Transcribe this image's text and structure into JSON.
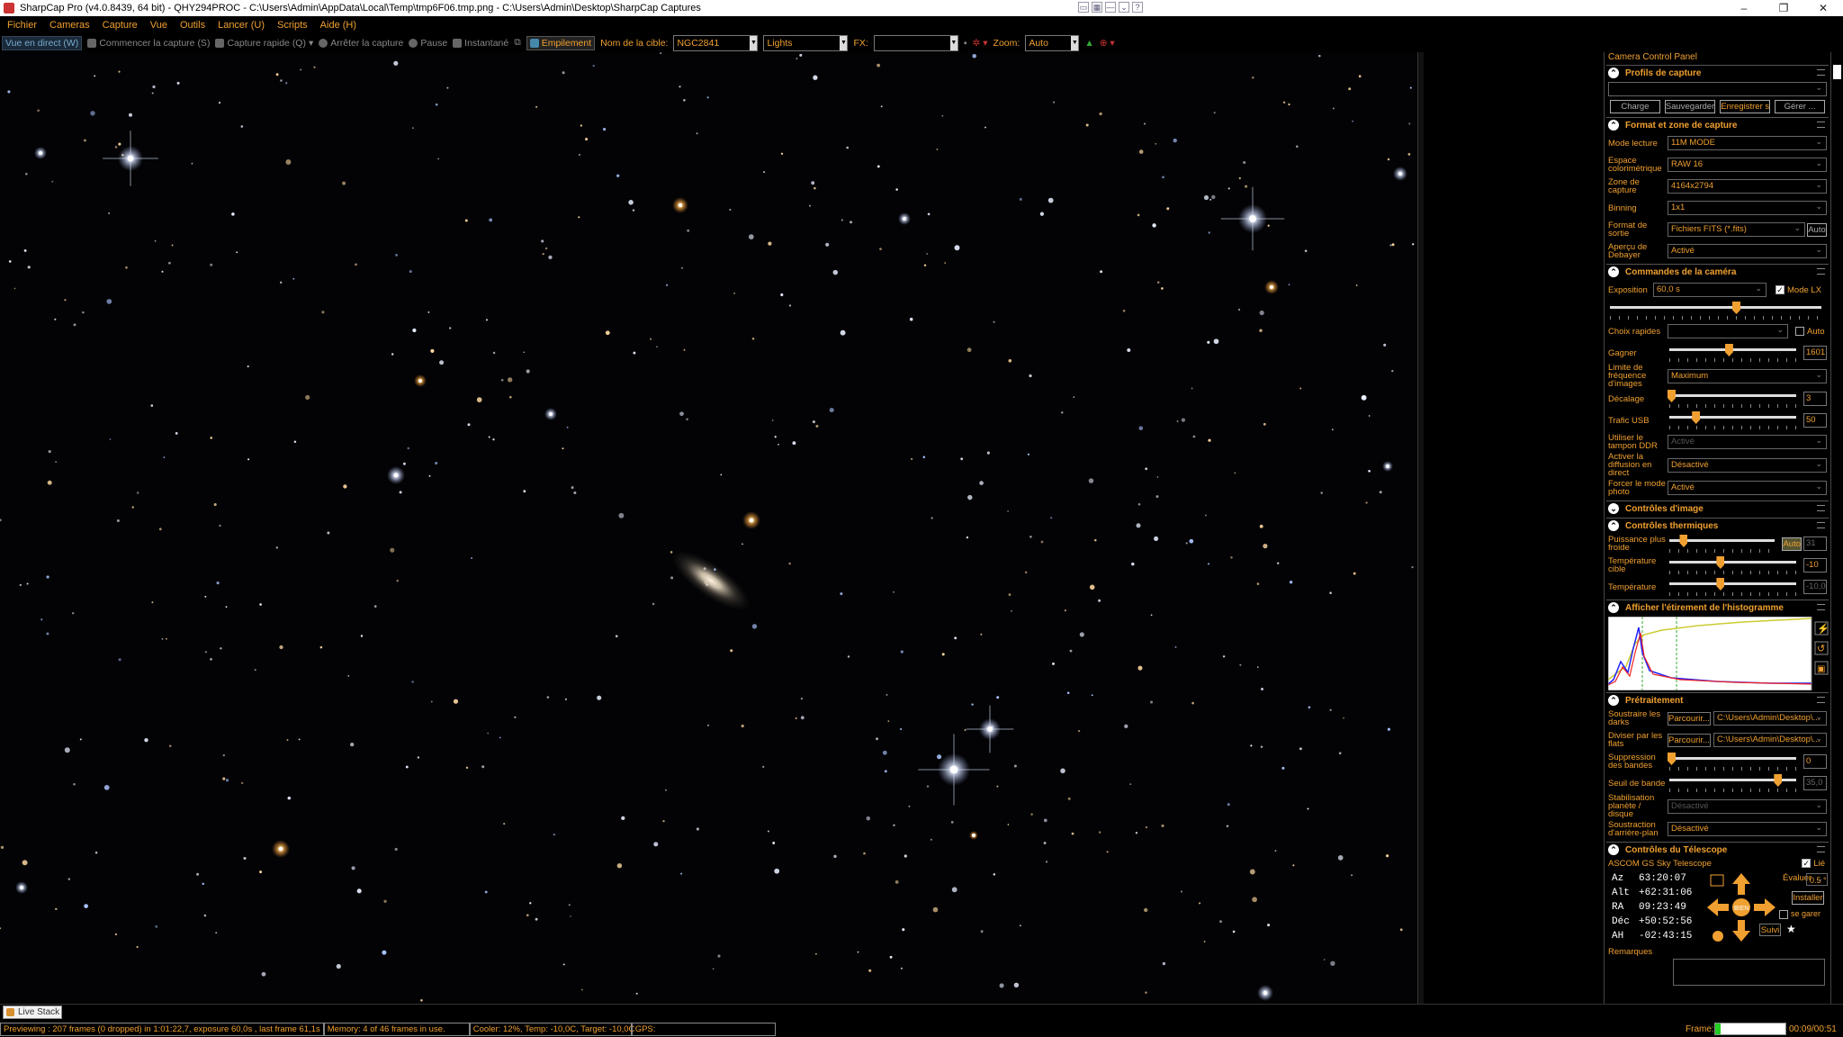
{
  "window": {
    "title": "SharpCap Pro (v4.0.8439, 64 bit) - QHY294PROC - C:\\Users\\Admin\\AppData\\Local\\Temp\\tmp6F06.tmp.png - C:\\Users\\Admin\\Desktop\\SharpCap Captures",
    "controls": [
      "–",
      "❐",
      "✕"
    ]
  },
  "menu": [
    "Fichier",
    "Cameras",
    "Capture",
    "Vue",
    "Outils",
    "Lancer (U)",
    "Scripts",
    "Aide (H)"
  ],
  "toolbar": {
    "live_view": "Vue en direct (W)",
    "start_capture": "Commencer la capture (S)",
    "quick_capture": "Capture rapide (Q)",
    "stop_capture": "Arrêter la capture",
    "pause": "Pause",
    "snapshot": "Instantané",
    "stacking": "Empilement",
    "target_label": "Nom de la cible:",
    "target_value": "NGC2841",
    "frame_type": "Lights",
    "fx_label": "FX:",
    "fx_value": "",
    "zoom_label": "Zoom:",
    "zoom_value": "Auto"
  },
  "panel": {
    "title": "Camera Control Panel",
    "profiles": {
      "heading": "Profils de capture",
      "buttons": [
        "Charge",
        "Sauvegarder",
        "Enregistrer s",
        "Gérer ..."
      ]
    },
    "format": {
      "heading": "Format et zone de capture",
      "rows": [
        {
          "label": "Mode lecture",
          "value": "11M MODE"
        },
        {
          "label": "Espace colorimétrique",
          "value": "RAW 16"
        },
        {
          "label": "Zone de capture",
          "value": "4164x2794"
        },
        {
          "label": "Binning",
          "value": "1x1"
        },
        {
          "label": "Format de sortie",
          "value": "Fichiers FITS (*.fits)",
          "extra": "Auto"
        },
        {
          "label": "Aperçu de Debayer",
          "value": "Activé"
        }
      ]
    },
    "camera": {
      "heading": "Commandes de la caméra",
      "exposure_label": "Exposition",
      "exposure_value": "60,0 s",
      "lx_mode": "Mode LX",
      "quick_choice": "Choix rapides",
      "auto": "Auto",
      "exposure_slider_pct": 0.6,
      "rows": [
        {
          "label": "Gagner",
          "type": "slider",
          "pct": 0.47,
          "value": "1601"
        },
        {
          "label": "Limite de fréquence d'images",
          "type": "dropdown",
          "value": "Maximum"
        },
        {
          "label": "Décalage",
          "type": "slider",
          "pct": 0.0,
          "value": "3"
        },
        {
          "label": "Trafic USB",
          "type": "slider",
          "pct": 0.2,
          "value": "50"
        },
        {
          "label": "Utiliser le tampon DDR",
          "type": "dropdown",
          "value": "Activé",
          "dim": true
        },
        {
          "label": "Activer la diffusion en direct",
          "type": "dropdown",
          "value": "Désactivé"
        },
        {
          "label": "Forcer le mode photo",
          "type": "dropdown",
          "value": "Activé"
        }
      ]
    },
    "image_controls": {
      "heading": "Contrôles d'image"
    },
    "thermal": {
      "heading": "Contrôles thermiques",
      "rows": [
        {
          "label": "Puissance plus froide",
          "pct": 0.12,
          "value": "31",
          "auto": "Auto"
        },
        {
          "label": "Température cible",
          "pct": 0.4,
          "value": "-10"
        },
        {
          "label": "Température",
          "pct": 0.4,
          "value": "-10,0"
        }
      ]
    },
    "histogram": {
      "heading": "Afficher l'étirement de l'histogramme"
    },
    "preprocess": {
      "heading": "Prétraitement",
      "subtract_darks": "Soustraire les darks",
      "divide_flats": "Diviser par les flats",
      "browse": "Parcourir...",
      "path": "C:\\Users\\Admin\\Desktop\\...",
      "band_suppression": "Suppression des bandes",
      "band_value": "0",
      "band_threshold": "Seuil de bande",
      "threshold_value": "35,0",
      "threshold_pct": 0.87,
      "stabilization": "Stabilisation planète / disque",
      "stabilization_value": "Désactivé",
      "background_sub": "Soustraction d'arrière-plan",
      "background_value": "Désactivé"
    },
    "telescope": {
      "heading": "Contrôles du Télescope",
      "mount": "ASCOM GS Sky Telescope",
      "linked": "Lié",
      "az": {
        "label": "Az",
        "value": "63:20:07"
      },
      "alt": {
        "label": "Alt",
        "value": "+62:31:06"
      },
      "ra": {
        "label": "RA",
        "value": "09:23:49"
      },
      "dec": {
        "label": "Déc",
        "value": "+50:52:56"
      },
      "ah": {
        "label": "AH",
        "value": "-02:43:15"
      },
      "evaluate": "Évaluer",
      "rate": "0.5 °",
      "install": "Installer",
      "park": "se garer",
      "track": "Suivi",
      "center": "BIEN"
    },
    "notes": "Remarques"
  },
  "status": {
    "live_stack": "Live Stack",
    "preview": "Previewing : 207 frames (0 dropped) in 1:01:22,7, exposure 60,0s , last frame 61,1s",
    "memory": "Memory: 4 of 46 frames in use.",
    "cooler": "Cooler: 12%, Temp: -10,0C, Target: -10,0C",
    "gps": "GPS:",
    "frame_label": "Frame:",
    "frame_progress": 0.08,
    "frame_time": "00:09/00:51"
  }
}
